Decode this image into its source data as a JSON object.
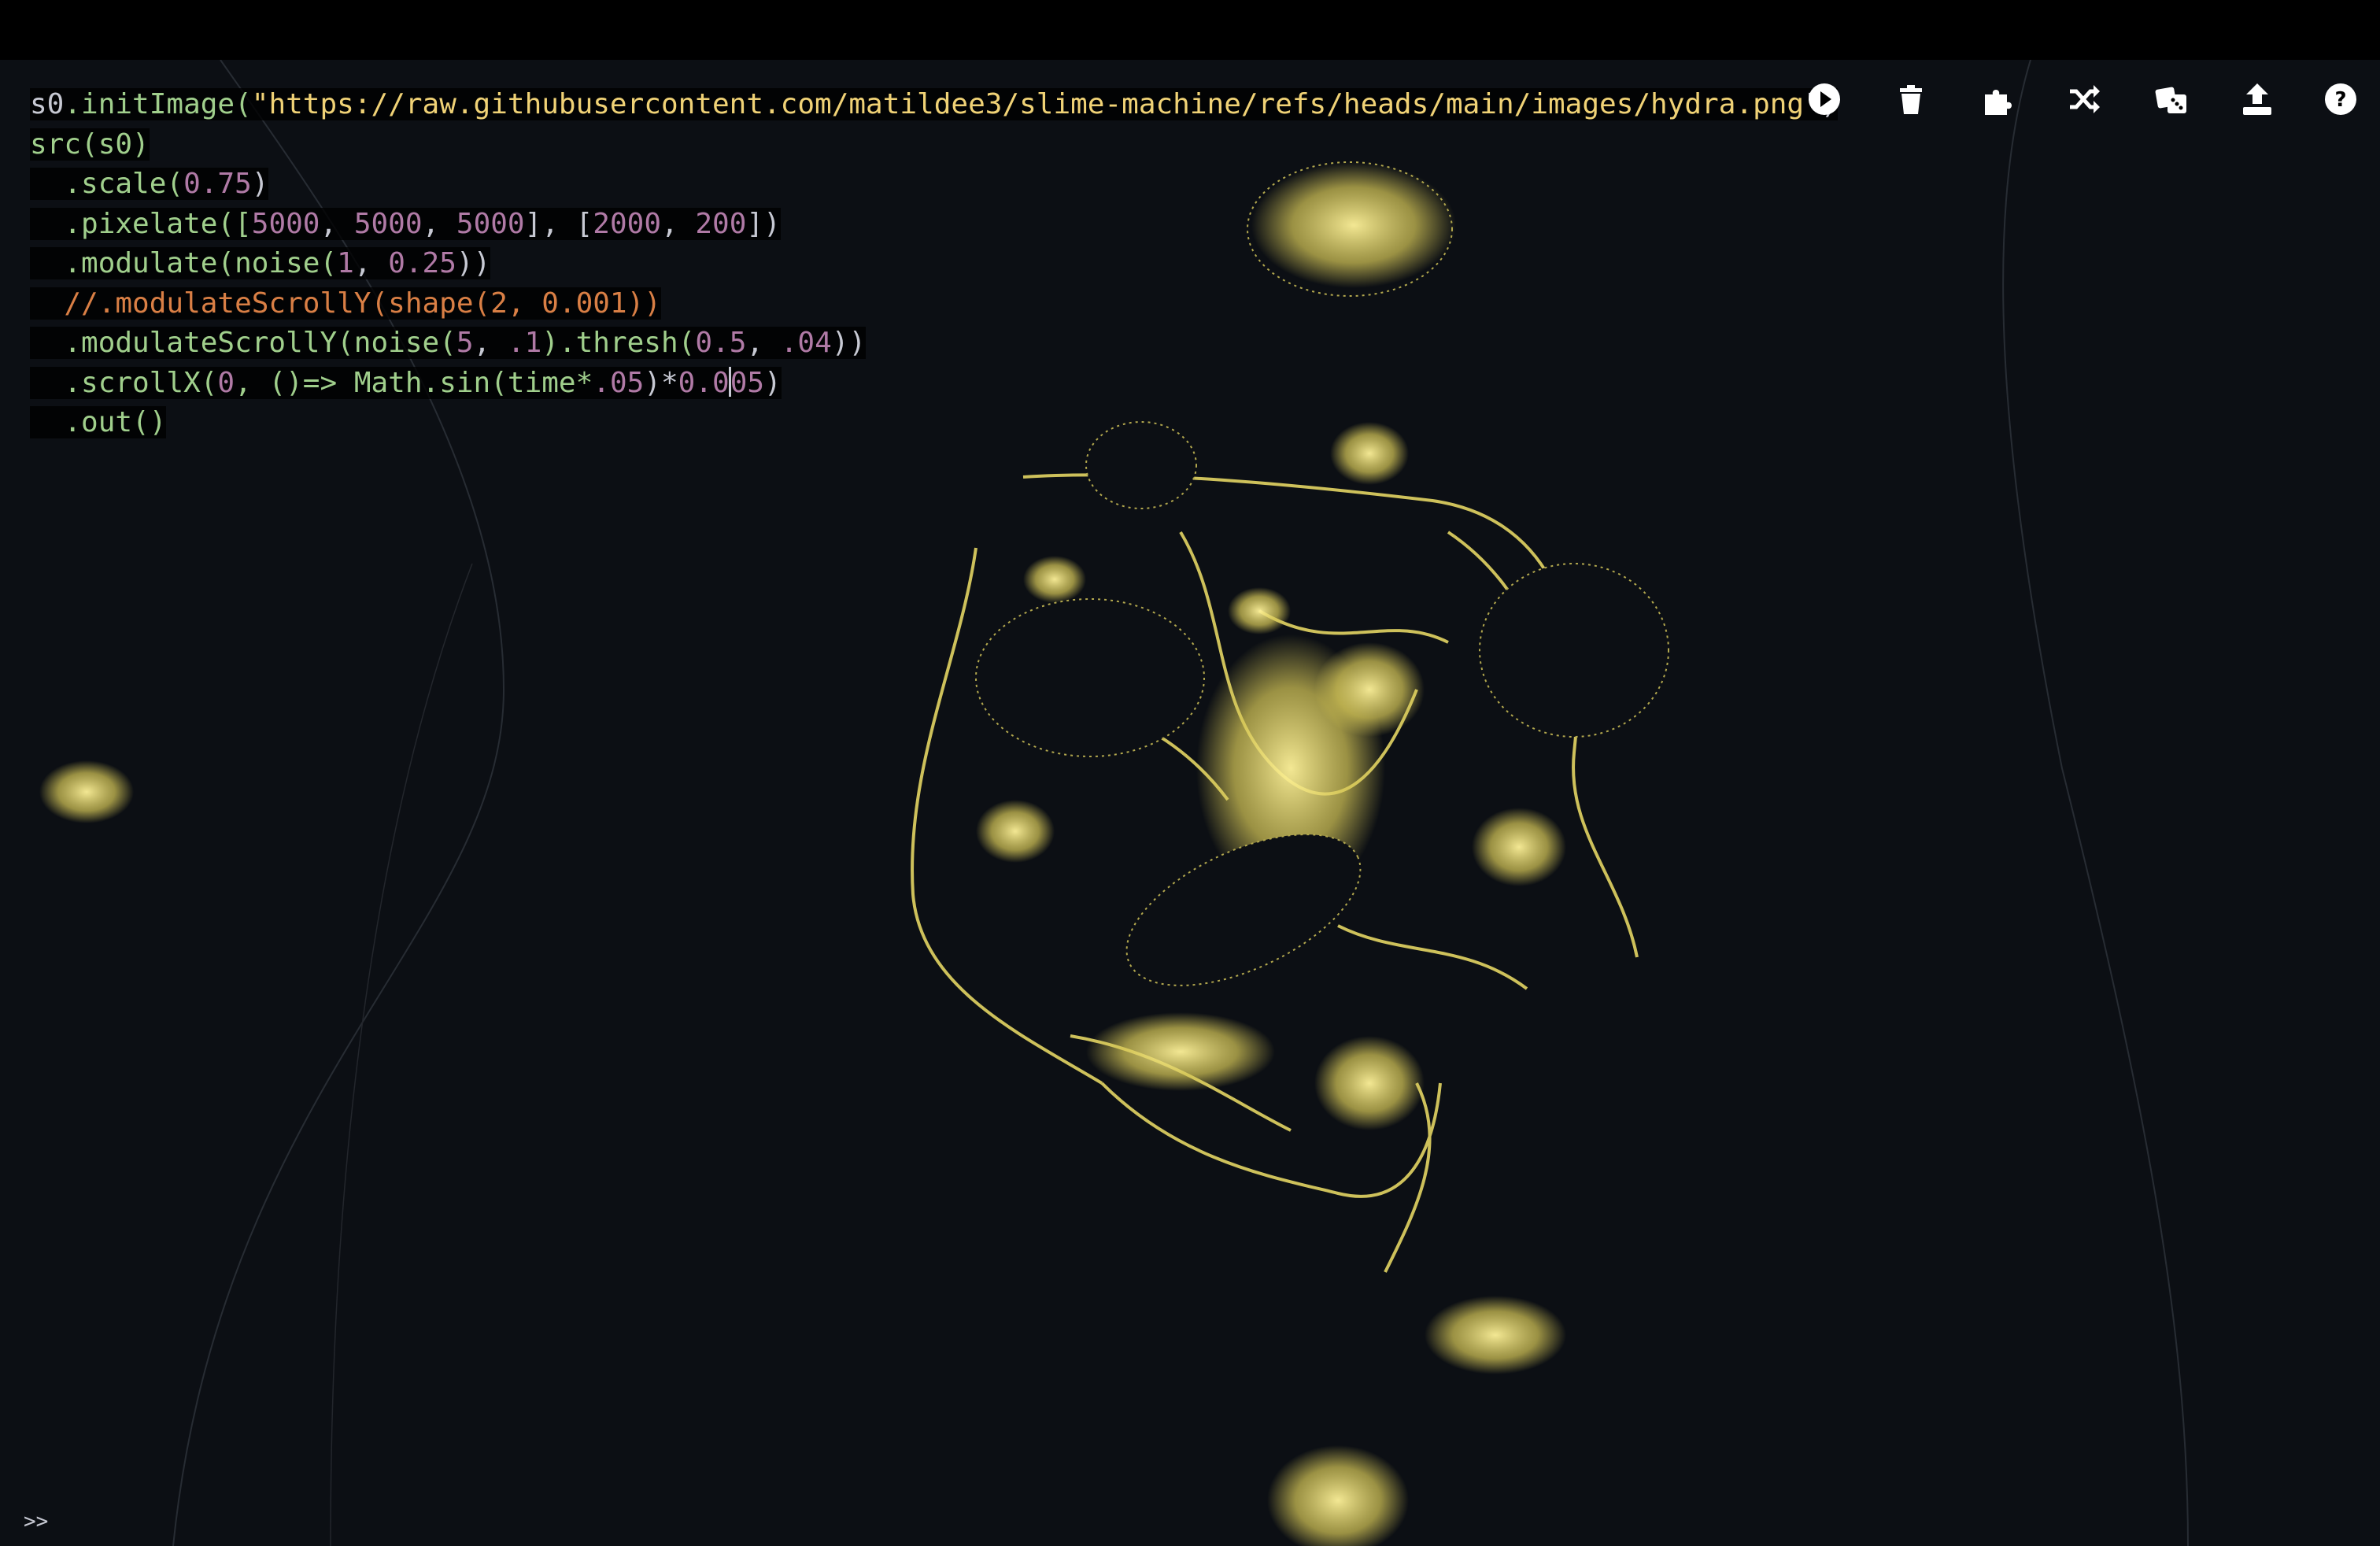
{
  "editor": {
    "lines": [
      {
        "parts": [
          {
            "t": "s0",
            "c": "tok-punct"
          },
          {
            "t": ".initImage(",
            "c": "tok-obj"
          },
          {
            "t": "\"https://raw.githubusercontent.com/matildee3/slime-machine/refs/heads/main/images/hydra.png",
            "c": "tok-str"
          },
          {
            "t": "\")",
            "c": "tok-punct"
          }
        ]
      },
      {
        "parts": [
          {
            "t": "src(s0)",
            "c": "tok-obj"
          }
        ]
      },
      {
        "parts": [
          {
            "t": "  .scale(",
            "c": "tok-obj"
          },
          {
            "t": "0.75",
            "c": "tok-num"
          },
          {
            "t": ")",
            "c": "tok-punct"
          }
        ]
      },
      {
        "parts": [
          {
            "t": "  .pixelate([",
            "c": "tok-obj"
          },
          {
            "t": "5000",
            "c": "tok-num"
          },
          {
            "t": ", ",
            "c": "tok-punct"
          },
          {
            "t": "5000",
            "c": "tok-num"
          },
          {
            "t": ", ",
            "c": "tok-punct"
          },
          {
            "t": "5000",
            "c": "tok-num"
          },
          {
            "t": "], [",
            "c": "tok-punct"
          },
          {
            "t": "2000",
            "c": "tok-num"
          },
          {
            "t": ", ",
            "c": "tok-punct"
          },
          {
            "t": "200",
            "c": "tok-num"
          },
          {
            "t": "])",
            "c": "tok-punct"
          }
        ]
      },
      {
        "parts": [
          {
            "t": "  .modulate(noise(",
            "c": "tok-obj"
          },
          {
            "t": "1",
            "c": "tok-num"
          },
          {
            "t": ", ",
            "c": "tok-punct"
          },
          {
            "t": "0.25",
            "c": "tok-num"
          },
          {
            "t": "))",
            "c": "tok-punct"
          }
        ]
      },
      {
        "parts": [
          {
            "t": "  //.modulateScrollY(shape(2, 0.001))",
            "c": "tok-comment"
          }
        ]
      },
      {
        "parts": [
          {
            "t": "  .modulateScrollY(noise(",
            "c": "tok-obj"
          },
          {
            "t": "5",
            "c": "tok-num"
          },
          {
            "t": ", ",
            "c": "tok-punct"
          },
          {
            "t": ".1",
            "c": "tok-num"
          },
          {
            "t": ").thresh(",
            "c": "tok-obj"
          },
          {
            "t": "0.5",
            "c": "tok-num"
          },
          {
            "t": ", ",
            "c": "tok-punct"
          },
          {
            "t": ".04",
            "c": "tok-num"
          },
          {
            "t": "))",
            "c": "tok-punct"
          }
        ]
      },
      {
        "parts": [
          {
            "t": "  .scrollX(",
            "c": "tok-obj"
          },
          {
            "t": "0",
            "c": "tok-num"
          },
          {
            "t": ", ()=> Math.sin(time*",
            "c": "tok-obj"
          },
          {
            "t": ".05",
            "c": "tok-num"
          },
          {
            "t": ")*",
            "c": "tok-punct"
          },
          {
            "t": "0.0",
            "c": "tok-num"
          },
          {
            "t": "|",
            "c": "cursor"
          },
          {
            "t": "05",
            "c": "tok-num"
          },
          {
            "t": ")",
            "c": "tok-punct"
          }
        ]
      },
      {
        "parts": [
          {
            "t": "  .out()",
            "c": "tok-obj"
          }
        ]
      }
    ]
  },
  "toolbar": [
    {
      "name": "run-button",
      "icon": "play-icon"
    },
    {
      "name": "clear-button",
      "icon": "trash-icon"
    },
    {
      "name": "extensions-button",
      "icon": "puzzle-icon"
    },
    {
      "name": "shuffle-button",
      "icon": "shuffle-icon"
    },
    {
      "name": "random-button",
      "icon": "dice-icon"
    },
    {
      "name": "share-button",
      "icon": "upload-icon"
    },
    {
      "name": "help-button",
      "icon": "help-icon"
    }
  ],
  "console": {
    "prompt": ">>"
  },
  "colors": {
    "slime": "#e8dc6a",
    "background": "#0c0f14"
  }
}
